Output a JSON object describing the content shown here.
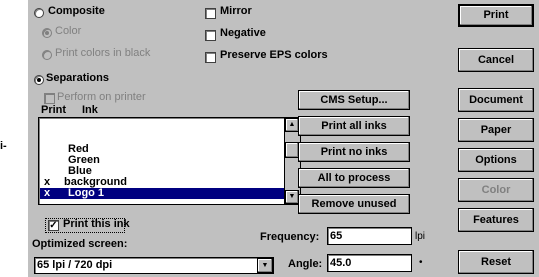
{
  "stray_text": "i-",
  "mode": {
    "composite": {
      "label": "Composite",
      "selected": false
    },
    "color": {
      "label": "Color"
    },
    "print_colors_in_black": {
      "label": "Print colors in black"
    },
    "separations": {
      "label": "Separations",
      "selected": true
    },
    "perform_on_printer": {
      "label": "Perform on printer"
    }
  },
  "options": {
    "mirror": {
      "label": "Mirror",
      "checked": false
    },
    "negative": {
      "label": "Negative",
      "checked": false
    },
    "preserve_eps": {
      "label": "Preserve EPS colors",
      "checked": false
    }
  },
  "ink_list": {
    "header_print": "Print",
    "header_ink": "Ink",
    "items": [
      {
        "mark": "",
        "name": "Red",
        "selected": false
      },
      {
        "mark": "",
        "name": "Green",
        "selected": false
      },
      {
        "mark": "",
        "name": "Blue",
        "selected": false
      },
      {
        "mark": "x",
        "name": "background",
        "selected": false
      },
      {
        "mark": "x",
        "name": "Logo 1",
        "selected": true
      }
    ],
    "print_this_ink": {
      "label": "Print this ink",
      "checked": true
    }
  },
  "middle_buttons": {
    "cms_setup": "CMS Setup...",
    "print_all_inks": "Print all inks",
    "print_no_inks": "Print no inks",
    "all_to_process": "All to process",
    "remove_unused": "Remove unused"
  },
  "screen": {
    "optimized_label": "Optimized screen:",
    "optimized_value": "65 lpi / 720 dpi",
    "frequency_label": "Frequency:",
    "frequency_value": "65",
    "frequency_unit": "lpi",
    "angle_label": "Angle:",
    "angle_value": "45.0",
    "angle_unit": "•"
  },
  "right_buttons": {
    "print": "Print",
    "cancel": "Cancel",
    "document": "Document",
    "paper": "Paper",
    "options": "Options",
    "color": "Color",
    "features": "Features",
    "reset": "Reset"
  },
  "icons": {
    "scroll_up": "▲",
    "scroll_down": "▼",
    "dropdown": "▼",
    "check": "✓"
  }
}
